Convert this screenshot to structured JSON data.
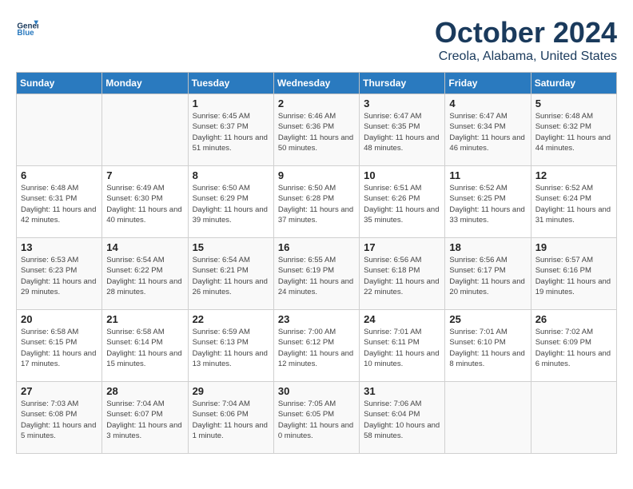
{
  "header": {
    "logo_line1": "General",
    "logo_line2": "Blue",
    "month": "October 2024",
    "location": "Creola, Alabama, United States"
  },
  "days_of_week": [
    "Sunday",
    "Monday",
    "Tuesday",
    "Wednesday",
    "Thursday",
    "Friday",
    "Saturday"
  ],
  "weeks": [
    [
      {
        "day": "",
        "content": ""
      },
      {
        "day": "",
        "content": ""
      },
      {
        "day": "1",
        "content": "Sunrise: 6:45 AM\nSunset: 6:37 PM\nDaylight: 11 hours\nand 51 minutes."
      },
      {
        "day": "2",
        "content": "Sunrise: 6:46 AM\nSunset: 6:36 PM\nDaylight: 11 hours\nand 50 minutes."
      },
      {
        "day": "3",
        "content": "Sunrise: 6:47 AM\nSunset: 6:35 PM\nDaylight: 11 hours\nand 48 minutes."
      },
      {
        "day": "4",
        "content": "Sunrise: 6:47 AM\nSunset: 6:34 PM\nDaylight: 11 hours\nand 46 minutes."
      },
      {
        "day": "5",
        "content": "Sunrise: 6:48 AM\nSunset: 6:32 PM\nDaylight: 11 hours\nand 44 minutes."
      }
    ],
    [
      {
        "day": "6",
        "content": "Sunrise: 6:48 AM\nSunset: 6:31 PM\nDaylight: 11 hours\nand 42 minutes."
      },
      {
        "day": "7",
        "content": "Sunrise: 6:49 AM\nSunset: 6:30 PM\nDaylight: 11 hours\nand 40 minutes."
      },
      {
        "day": "8",
        "content": "Sunrise: 6:50 AM\nSunset: 6:29 PM\nDaylight: 11 hours\nand 39 minutes."
      },
      {
        "day": "9",
        "content": "Sunrise: 6:50 AM\nSunset: 6:28 PM\nDaylight: 11 hours\nand 37 minutes."
      },
      {
        "day": "10",
        "content": "Sunrise: 6:51 AM\nSunset: 6:26 PM\nDaylight: 11 hours\nand 35 minutes."
      },
      {
        "day": "11",
        "content": "Sunrise: 6:52 AM\nSunset: 6:25 PM\nDaylight: 11 hours\nand 33 minutes."
      },
      {
        "day": "12",
        "content": "Sunrise: 6:52 AM\nSunset: 6:24 PM\nDaylight: 11 hours\nand 31 minutes."
      }
    ],
    [
      {
        "day": "13",
        "content": "Sunrise: 6:53 AM\nSunset: 6:23 PM\nDaylight: 11 hours\nand 29 minutes."
      },
      {
        "day": "14",
        "content": "Sunrise: 6:54 AM\nSunset: 6:22 PM\nDaylight: 11 hours\nand 28 minutes."
      },
      {
        "day": "15",
        "content": "Sunrise: 6:54 AM\nSunset: 6:21 PM\nDaylight: 11 hours\nand 26 minutes."
      },
      {
        "day": "16",
        "content": "Sunrise: 6:55 AM\nSunset: 6:19 PM\nDaylight: 11 hours\nand 24 minutes."
      },
      {
        "day": "17",
        "content": "Sunrise: 6:56 AM\nSunset: 6:18 PM\nDaylight: 11 hours\nand 22 minutes."
      },
      {
        "day": "18",
        "content": "Sunrise: 6:56 AM\nSunset: 6:17 PM\nDaylight: 11 hours\nand 20 minutes."
      },
      {
        "day": "19",
        "content": "Sunrise: 6:57 AM\nSunset: 6:16 PM\nDaylight: 11 hours\nand 19 minutes."
      }
    ],
    [
      {
        "day": "20",
        "content": "Sunrise: 6:58 AM\nSunset: 6:15 PM\nDaylight: 11 hours\nand 17 minutes."
      },
      {
        "day": "21",
        "content": "Sunrise: 6:58 AM\nSunset: 6:14 PM\nDaylight: 11 hours\nand 15 minutes."
      },
      {
        "day": "22",
        "content": "Sunrise: 6:59 AM\nSunset: 6:13 PM\nDaylight: 11 hours\nand 13 minutes."
      },
      {
        "day": "23",
        "content": "Sunrise: 7:00 AM\nSunset: 6:12 PM\nDaylight: 11 hours\nand 12 minutes."
      },
      {
        "day": "24",
        "content": "Sunrise: 7:01 AM\nSunset: 6:11 PM\nDaylight: 11 hours\nand 10 minutes."
      },
      {
        "day": "25",
        "content": "Sunrise: 7:01 AM\nSunset: 6:10 PM\nDaylight: 11 hours\nand 8 minutes."
      },
      {
        "day": "26",
        "content": "Sunrise: 7:02 AM\nSunset: 6:09 PM\nDaylight: 11 hours\nand 6 minutes."
      }
    ],
    [
      {
        "day": "27",
        "content": "Sunrise: 7:03 AM\nSunset: 6:08 PM\nDaylight: 11 hours\nand 5 minutes."
      },
      {
        "day": "28",
        "content": "Sunrise: 7:04 AM\nSunset: 6:07 PM\nDaylight: 11 hours\nand 3 minutes."
      },
      {
        "day": "29",
        "content": "Sunrise: 7:04 AM\nSunset: 6:06 PM\nDaylight: 11 hours\nand 1 minute."
      },
      {
        "day": "30",
        "content": "Sunrise: 7:05 AM\nSunset: 6:05 PM\nDaylight: 11 hours\nand 0 minutes."
      },
      {
        "day": "31",
        "content": "Sunrise: 7:06 AM\nSunset: 6:04 PM\nDaylight: 10 hours\nand 58 minutes."
      },
      {
        "day": "",
        "content": ""
      },
      {
        "day": "",
        "content": ""
      }
    ]
  ]
}
